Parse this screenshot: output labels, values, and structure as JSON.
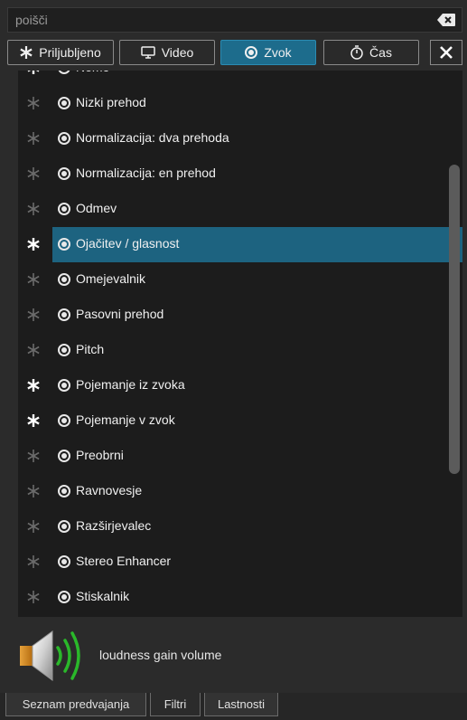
{
  "search": {
    "placeholder": "poišči",
    "value": ""
  },
  "tabs": [
    {
      "label": "Priljubljeno",
      "icon": "star-icon",
      "active": false
    },
    {
      "label": "Video",
      "icon": "monitor-icon",
      "active": false
    },
    {
      "label": "Zvok",
      "icon": "audio-icon",
      "active": true
    },
    {
      "label": "Čas",
      "icon": "stopwatch-icon",
      "active": false
    }
  ],
  "filters": [
    {
      "label": "Nemo",
      "favorite": true,
      "selected": false
    },
    {
      "label": "Nizki prehod",
      "favorite": false,
      "selected": false
    },
    {
      "label": "Normalizacija: dva prehoda",
      "favorite": false,
      "selected": false
    },
    {
      "label": "Normalizacija: en prehod",
      "favorite": false,
      "selected": false
    },
    {
      "label": "Odmev",
      "favorite": false,
      "selected": false
    },
    {
      "label": "Ojačitev / glasnost",
      "favorite": true,
      "selected": true
    },
    {
      "label": "Omejevalnik",
      "favorite": false,
      "selected": false
    },
    {
      "label": "Pasovni prehod",
      "favorite": false,
      "selected": false
    },
    {
      "label": "Pitch",
      "favorite": false,
      "selected": false
    },
    {
      "label": "Pojemanje iz zvoka",
      "favorite": true,
      "selected": false
    },
    {
      "label": "Pojemanje v zvok",
      "favorite": true,
      "selected": false
    },
    {
      "label": "Preobrni",
      "favorite": false,
      "selected": false
    },
    {
      "label": "Ravnovesje",
      "favorite": false,
      "selected": false
    },
    {
      "label": "Razširjevalec",
      "favorite": false,
      "selected": false
    },
    {
      "label": "Stereo Enhancer",
      "favorite": false,
      "selected": false
    },
    {
      "label": "Stiskalnik",
      "favorite": false,
      "selected": false
    }
  ],
  "description": {
    "text": "loudness gain volume"
  },
  "bottom_tabs": [
    {
      "label": "Seznam predvajanja",
      "active": false
    },
    {
      "label": "Filtri",
      "active": true
    },
    {
      "label": "Lastnosti",
      "active": false
    }
  ],
  "colors": {
    "accent": "#1d6c8c",
    "selected_row": "#1d6380",
    "favorite_on": "#ffffff",
    "favorite_off": "#6b6b6b",
    "speaker_waves": "#2ab82a"
  }
}
